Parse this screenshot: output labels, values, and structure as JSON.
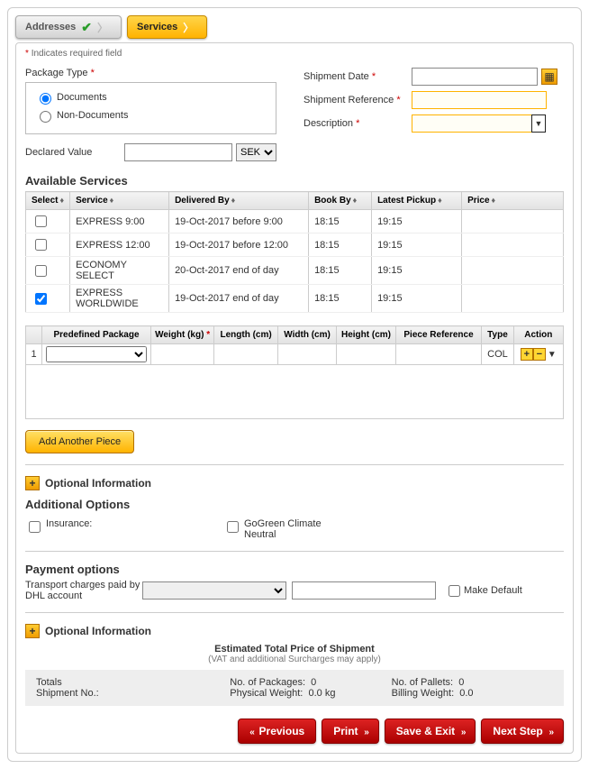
{
  "tabs": {
    "addresses": "Addresses",
    "services": "Services"
  },
  "required_note": "Indicates required field",
  "labels": {
    "package_type": "Package Type",
    "documents": "Documents",
    "non_documents": "Non-Documents",
    "declared_value": "Declared Value",
    "shipment_date": "Shipment Date",
    "shipment_ref": "Shipment Reference",
    "description": "Description"
  },
  "currency_selected": "SEK",
  "available_services": {
    "title": "Available Services",
    "columns": {
      "select": "Select",
      "service": "Service",
      "delivered_by": "Delivered By",
      "book_by": "Book By",
      "latest_pickup": "Latest Pickup",
      "price": "Price"
    },
    "rows": [
      {
        "checked": false,
        "service": "EXPRESS 9:00",
        "delivered": "19-Oct-2017 before 9:00",
        "book": "18:15",
        "pickup": "19:15"
      },
      {
        "checked": false,
        "service": "EXPRESS 12:00",
        "delivered": "19-Oct-2017 before 12:00",
        "book": "18:15",
        "pickup": "19:15"
      },
      {
        "checked": false,
        "service": "ECONOMY SELECT",
        "delivered": "20-Oct-2017 end of day",
        "book": "18:15",
        "pickup": "19:15"
      },
      {
        "checked": true,
        "service": "EXPRESS WORLDWIDE",
        "delivered": "19-Oct-2017 end of day",
        "book": "18:15",
        "pickup": "19:15"
      }
    ]
  },
  "pieces": {
    "columns": {
      "predefined": "Predefined Package",
      "weight": "Weight (kg)",
      "length": "Length (cm)",
      "width": "Width (cm)",
      "height": "Height (cm)",
      "piece_ref": "Piece Reference",
      "type": "Type",
      "action": "Action"
    },
    "row": {
      "num": "1",
      "type": "COL"
    }
  },
  "add_piece": "Add Another Piece",
  "optional_info": "Optional Information",
  "additional_options": {
    "title": "Additional Options",
    "insurance": "Insurance:",
    "gogreen": "GoGreen Climate Neutral"
  },
  "payment": {
    "title": "Payment options",
    "transport": "Transport charges paid by DHL account",
    "make_default": "Make Default"
  },
  "estimate": {
    "title": "Estimated Total Price of Shipment",
    "sub": "(VAT and additional Surcharges may apply)"
  },
  "totals": {
    "totals_lbl": "Totals",
    "shipment_no": "Shipment No.:",
    "no_packages": "No. of Packages:",
    "no_packages_v": "0",
    "no_pallets": "No. of Pallets:",
    "no_pallets_v": "0",
    "phys_weight": "Physical Weight:",
    "phys_weight_v": "0.0 kg",
    "bill_weight": "Billing Weight:",
    "bill_weight_v": "0.0"
  },
  "footer": {
    "previous": "Previous",
    "print": "Print",
    "save_exit": "Save & Exit",
    "next_step": "Next Step"
  }
}
